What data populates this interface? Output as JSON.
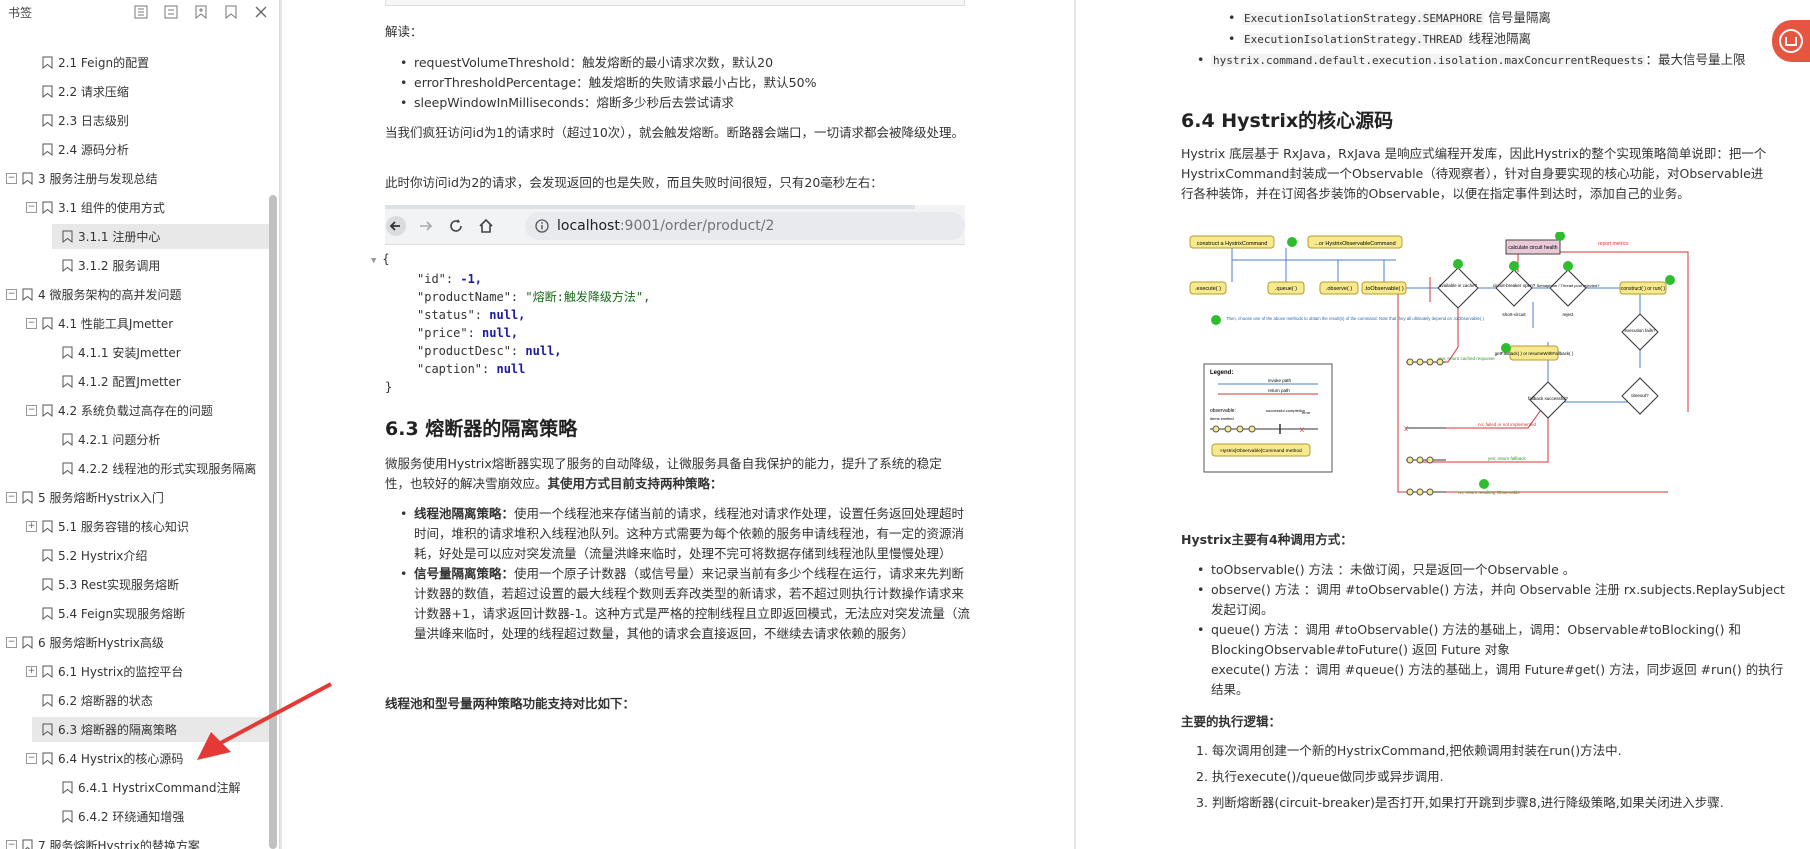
{
  "sidebar": {
    "title": "书签",
    "tools": [
      "expand-all-icon",
      "collapse-all-icon",
      "add-bookmark-icon",
      "bookmark-icon",
      "close-icon"
    ],
    "items": [
      {
        "label": "2.1 Feign的配置",
        "level": 2,
        "toggle": ""
      },
      {
        "label": "2.2 请求压缩",
        "level": 2,
        "toggle": ""
      },
      {
        "label": "2.3 日志级别",
        "level": 2,
        "toggle": ""
      },
      {
        "label": "2.4 源码分析",
        "level": 2,
        "toggle": ""
      },
      {
        "label": "3 服务注册与发现总结",
        "level": 1,
        "toggle": "−"
      },
      {
        "label": "3.1 组件的使用方式",
        "level": 2,
        "toggle": "−"
      },
      {
        "label": "3.1.1 注册中心",
        "level": 3,
        "toggle": ""
      },
      {
        "label": "3.1.2 服务调用",
        "level": 3,
        "toggle": ""
      },
      {
        "label": "4 微服务架构的高并发问题",
        "level": 1,
        "toggle": "−"
      },
      {
        "label": "4.1 性能工具Jmetter",
        "level": 2,
        "toggle": "−"
      },
      {
        "label": "4.1.1 安装Jmetter",
        "level": 3,
        "toggle": ""
      },
      {
        "label": "4.1.2 配置Jmetter",
        "level": 3,
        "toggle": ""
      },
      {
        "label": "4.2 系统负载过高存在的问题",
        "level": 2,
        "toggle": "−"
      },
      {
        "label": "4.2.1 问题分析",
        "level": 3,
        "toggle": ""
      },
      {
        "label": "4.2.2 线程池的形式实现服务隔离",
        "level": 3,
        "toggle": ""
      },
      {
        "label": "5 服务熔断Hystrix入门",
        "level": 1,
        "toggle": "−"
      },
      {
        "label": "5.1 服务容错的核心知识",
        "level": 2,
        "toggle": "+"
      },
      {
        "label": "5.2 Hystrix介绍",
        "level": 2,
        "toggle": ""
      },
      {
        "label": "5.3 Rest实现服务熔断",
        "level": 2,
        "toggle": ""
      },
      {
        "label": "5.4 Feign实现服务熔断",
        "level": 2,
        "toggle": ""
      },
      {
        "label": "6 服务熔断Hystrix高级",
        "level": 1,
        "toggle": "−"
      },
      {
        "label": "6.1 Hystrix的监控平台",
        "level": 2,
        "toggle": "+"
      },
      {
        "label": "6.2 熔断器的状态",
        "level": 2,
        "toggle": ""
      },
      {
        "label": "6.3 熔断器的隔离策略",
        "level": 2,
        "toggle": ""
      },
      {
        "label": "6.4 Hystrix的核心源码",
        "level": 2,
        "toggle": "−"
      },
      {
        "label": "6.4.1 HystrixCommand注解",
        "level": 3,
        "toggle": ""
      },
      {
        "label": "6.4.2 环绕通知增强",
        "level": 3,
        "toggle": ""
      },
      {
        "label": "7 服务熔断Hystrix的替换方案",
        "level": 1,
        "toggle": "−"
      }
    ]
  },
  "left_page": {
    "read_label": "解读：",
    "bullets1": [
      "requestVolumeThreshold：触发熔断的最小请求次数，默认20",
      "errorThresholdPercentage：触发熔断的失败请求最小占比，默认50%",
      "sleepWindowInMilliseconds：熔断多少秒后去尝试请求"
    ],
    "para1": "当我们疯狂访问id为1的请求时（超过10次），就会触发熔断。断路器会端口，一切请求都会被降级处理。",
    "para2": "此时你访问id为2的请求，会发现返回的也是失败，而且失败时间很短，只有20毫秒左右：",
    "url_host": "localhost",
    "url_rest": ":9001/order/product/2",
    "json_lines": {
      "open": "{",
      "id_key": "\"id\":",
      "id_val": "-1,",
      "name_key": "\"productName\":",
      "name_val": "\"熔断:触发降级方法\",",
      "status_key": "\"status\":",
      "price_key": "\"price\":",
      "desc_key": "\"productDesc\":",
      "caption_key": "\"caption\":",
      "null_comma": "null,",
      "null": "null",
      "close": "}",
      "collapse": "▼"
    },
    "h63": "6.3 熔断器的隔离策略",
    "para3a": "微服务使用Hystrix熔断器实现了服务的自动降级，让微服务具备自我保护的能力，提升了系统的稳定性，也较好的解决雪崩效应。",
    "para3b": "其使用方式目前支持两种策略：",
    "s1_title": "线程池隔离策略：",
    "s1_text": "使用一个线程池来存储当前的请求，线程池对请求作处理，设置任务返回处理超时时间，堆积的请求堆积入线程池队列。这种方式需要为每个依赖的服务申请线程池，有一定的资源消耗，好处是可以应对突发流量（流量洪峰来临时，处理不完可将数据存储到线程池队里慢慢处理）",
    "s2_title": "信号量隔离策略：",
    "s2_text": "使用一个原子计数器（或信号量）来记录当前有多少个线程在运行，请求来先判断计数器的数值，若超过设置的最大线程个数则丢弃改类型的新请求，若不超过则执行计数操作请求来计数器+1，请求返回计数器-1。这种方式是严格的控制线程且立即返回模式，无法应对突发流量（流量洪峰来临时，处理的线程超过数量，其他的请求会直接返回，不继续去请求依赖的服务）",
    "compare": "线程池和型号量两种策略功能支持对比如下："
  },
  "right_page": {
    "c1": "ExecutionIsolationStrategy.SEMAPHORE",
    "c1_text": " 信号量隔离",
    "c2": "ExecutionIsolationStrategy.THREAD",
    "c2_text": " 线程池隔离",
    "c3": "hystrix.command.default.execution.isolation.maxConcurrentRequests",
    "c3_text": "：最大信号量上限",
    "h64": "6.4 Hystrix的核心源码",
    "para1": "Hystrix 底层基于 RxJava，RxJava 是响应式编程开发库，因此Hystrix的整个实现策略简单说即：把一个HystrixCommand封装成一个Observable（待观察者），针对自身要实现的核心功能，对Observable进行各种装饰，并在订阅各步装饰的Observable，以便在指定事件到达时，添加自己的业务。",
    "diagram": {
      "construct": "construct a HystrixCommand",
      "construct2": "...or HystrixObservableCommand",
      "execute": ".execute( )",
      "queue": ".queue( )",
      "observe": ".observe( )",
      "toObservable": ".toObservable( )",
      "cached": "available in cache?",
      "circuit": "circuit-breaker open?",
      "semaphore": "Semaphore / Thread pool rejected?",
      "construct_run": "construct( ) or run( )",
      "calc": "calculate circuit health",
      "report": "report metrics",
      "fallback": "getFallback( ) or resumeWithFallback( )",
      "fallback_ok": "fallback successful?",
      "exec_fails": "execution fails?",
      "timeout": "timeout?",
      "choose": "Then, choose one of the above methods to obtain the result(s) of the command. Note that they all ultimately depend on .toObservable( )",
      "legend": "Legend:",
      "invoke": "invoke path",
      "return": "return path",
      "observable": "observable:",
      "items": "items emitted",
      "success": "successful completion",
      "error": "error",
      "method": "Hystrix[Observable]Command method",
      "yes_cached": "yes; return cached response",
      "no_failed": "no; failed or not implemented",
      "yes_fallback": "yes; return fallback",
      "return_obs": "no; return resulting Observable",
      "short_circuit": "short-circuit",
      "reject": "reject",
      "yes": "yes",
      "no": "no",
      "nums": [
        "1",
        "2",
        "3",
        "4",
        "5",
        "6",
        "7",
        "8",
        "9"
      ]
    },
    "calls_title": "Hystrix主要有4种调用方式：",
    "calls": [
      "toObservable() 方法 ：未做订阅，只是返回一个Observable 。",
      "observe() 方法 ：调用 #toObservable() 方法，并向 Observable 注册 rx.subjects.ReplaySubject 发起订阅。",
      "queue() 方法 ：调用 #toObservable() 方法的基础上，调用：Observable#toBlocking() 和 BlockingObservable#toFuture() 返回 Future 对象",
      "execute() 方法 ：调用 #queue() 方法的基础上，调用 Future#get() 方法，同步返回 #run() 的执行结果。"
    ],
    "logic_title": "主要的执行逻辑：",
    "logic": [
      "1. 每次调用创建一个新的HystrixCommand,把依赖调用封装在run()方法中.",
      "2. 执行execute()/queue做同步或异步调用.",
      "3. 判断熔断器(circuit-breaker)是否打开,如果打开跳到步骤8,进行降级策略,如果关闭进入步骤."
    ]
  },
  "colors": {
    "accent_red": "#e53935",
    "diagram_yellow": "#f7e98d",
    "diagram_blue": "#4a7fd1",
    "diagram_red": "#d33",
    "diagram_green": "#2ebd2e"
  }
}
